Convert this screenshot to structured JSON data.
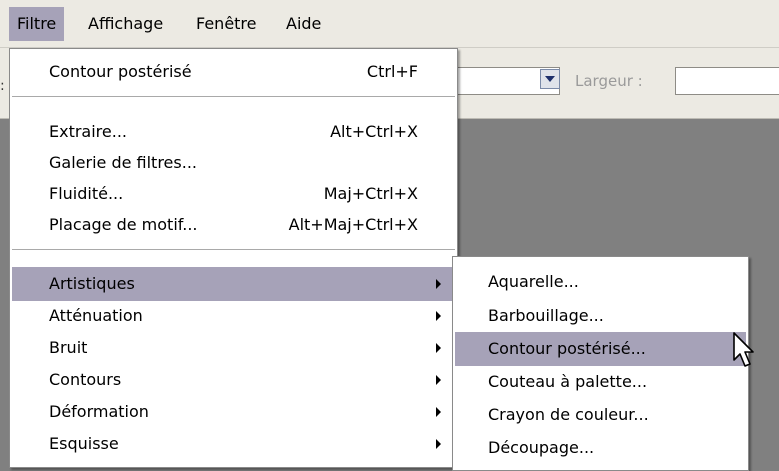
{
  "menubar": {
    "items": [
      "Filtre",
      "Affichage",
      "Fenêtre",
      "Aide"
    ]
  },
  "optbar": {
    "left_fragment": ":",
    "largeur_label": "Largeur :"
  },
  "filter_menu": {
    "last_filter": {
      "label": "Contour postérisé",
      "shortcut": "Ctrl+F"
    },
    "items": [
      {
        "label": "Extraire...",
        "shortcut": "Alt+Ctrl+X"
      },
      {
        "label": "Galerie de filtres...",
        "shortcut": ""
      },
      {
        "label": "Fluidité...",
        "shortcut": "Maj+Ctrl+X"
      },
      {
        "label": "Placage de motif...",
        "shortcut": "Alt+Maj+Ctrl+X"
      }
    ],
    "submenus": [
      "Artistiques",
      "Atténuation",
      "Bruit",
      "Contours",
      "Déformation",
      "Esquisse"
    ]
  },
  "artistiques_submenu": {
    "items": [
      "Aquarelle...",
      "Barbouillage...",
      "Contour postérisé...",
      "Couteau à palette...",
      "Crayon de couleur...",
      "Découpage..."
    ]
  },
  "colors": {
    "highlight": "#a6a2b8",
    "menubar_bg": "#eceae3",
    "canvas_bg": "#808080"
  }
}
